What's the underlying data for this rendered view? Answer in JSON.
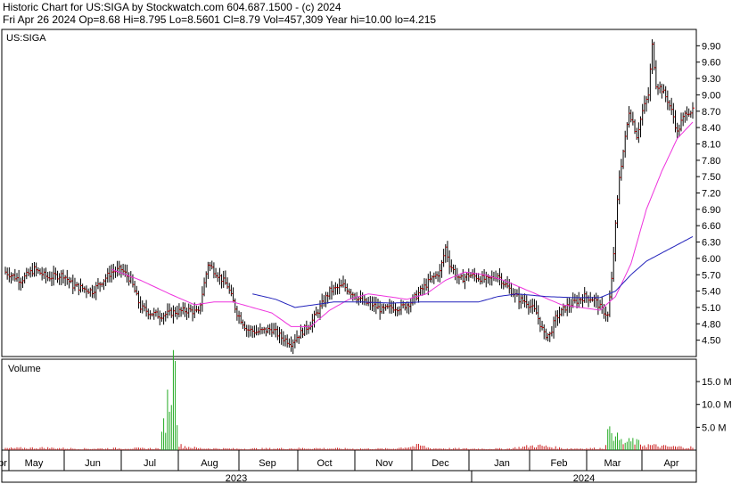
{
  "header": {
    "line1": "Historic Chart for US:SIGA by Stockwatch.com 604.687.1500 - (c) 2024",
    "line2": "Fri Apr 26 2024  Op=8.68  Hi=8.795  Lo=8.5601  Cl=8.79  Vol=457,309  Year hi=10.00  lo=4.215"
  },
  "chart_data": {
    "type": "ohlc",
    "symbol_label": "US:SIGA",
    "volume_label": "Volume",
    "price_ticks": [
      "9.90",
      "9.60",
      "9.30",
      "9.00",
      "8.70",
      "8.40",
      "8.10",
      "7.80",
      "7.50",
      "7.20",
      "6.90",
      "6.60",
      "6.30",
      "6.00",
      "5.70",
      "5.40",
      "5.10",
      "4.80",
      "4.50"
    ],
    "price_tick_values": [
      9.9,
      9.6,
      9.3,
      9.0,
      8.7,
      8.4,
      8.1,
      7.8,
      7.5,
      7.2,
      6.9,
      6.6,
      6.3,
      6.0,
      5.7,
      5.4,
      5.1,
      4.8,
      4.5
    ],
    "ylim": [
      4.2,
      10.2
    ],
    "volume_ticks": [
      "15.0 M",
      "10.0 M",
      "5.0 M"
    ],
    "volume_tick_values": [
      15,
      10,
      5
    ],
    "volume_ylim": [
      0,
      19.5
    ],
    "months": [
      "pr",
      "May",
      "Jun",
      "Jul",
      "Aug",
      "Sep",
      "Oct",
      "Nov",
      "Dec",
      "Jan",
      "Feb",
      "Mar",
      "Apr"
    ],
    "years": [
      "2023",
      "2024"
    ],
    "price_anchors": [
      [
        0,
        5.75
      ],
      [
        8,
        5.6
      ],
      [
        15,
        5.8
      ],
      [
        22,
        5.65
      ],
      [
        30,
        5.7
      ],
      [
        35,
        5.5
      ],
      [
        45,
        5.4
      ],
      [
        55,
        5.75
      ],
      [
        60,
        5.8
      ],
      [
        65,
        5.6
      ],
      [
        70,
        5.1
      ],
      [
        75,
        5.0
      ],
      [
        80,
        4.95
      ],
      [
        88,
        5.02
      ],
      [
        95,
        5.05
      ],
      [
        100,
        5.0
      ],
      [
        105,
        5.9
      ],
      [
        110,
        5.7
      ],
      [
        115,
        5.5
      ],
      [
        120,
        5.0
      ],
      [
        125,
        4.7
      ],
      [
        130,
        4.65
      ],
      [
        138,
        4.7
      ],
      [
        143,
        4.55
      ],
      [
        148,
        4.45
      ],
      [
        152,
        4.6
      ],
      [
        158,
        4.8
      ],
      [
        163,
        5.1
      ],
      [
        168,
        5.4
      ],
      [
        175,
        5.5
      ],
      [
        180,
        5.35
      ],
      [
        185,
        5.2
      ],
      [
        190,
        5.15
      ],
      [
        195,
        5.05
      ],
      [
        200,
        5.1
      ],
      [
        205,
        5.1
      ],
      [
        210,
        5.2
      ],
      [
        215,
        5.4
      ],
      [
        220,
        5.6
      ],
      [
        225,
        5.75
      ],
      [
        228,
        6.2
      ],
      [
        230,
        5.9
      ],
      [
        235,
        5.6
      ],
      [
        240,
        5.7
      ],
      [
        245,
        5.65
      ],
      [
        250,
        5.6
      ],
      [
        255,
        5.7
      ],
      [
        258,
        5.55
      ],
      [
        262,
        5.4
      ],
      [
        266,
        5.25
      ],
      [
        270,
        5.2
      ],
      [
        275,
        5.0
      ],
      [
        279,
        4.6
      ],
      [
        282,
        4.6
      ],
      [
        285,
        4.9
      ],
      [
        290,
        5.1
      ],
      [
        295,
        5.2
      ],
      [
        300,
        5.3
      ],
      [
        305,
        5.25
      ],
      [
        308,
        5.1
      ],
      [
        312,
        4.95
      ],
      [
        314,
        5.6
      ],
      [
        316,
        6.6
      ],
      [
        318,
        7.5
      ],
      [
        321,
        8.2
      ],
      [
        323,
        8.7
      ],
      [
        325,
        8.5
      ],
      [
        327,
        8.25
      ],
      [
        330,
        8.7
      ],
      [
        333,
        9.0
      ],
      [
        335,
        9.9
      ],
      [
        337,
        9.2
      ],
      [
        340,
        9.1
      ],
      [
        343,
        8.9
      ],
      [
        346,
        8.6
      ],
      [
        348,
        8.3
      ],
      [
        350,
        8.5
      ],
      [
        353,
        8.7
      ]
    ],
    "ma_short_anchors": [
      [
        55,
        5.8
      ],
      [
        70,
        5.6
      ],
      [
        85,
        5.35
      ],
      [
        98,
        5.15
      ],
      [
        108,
        5.2
      ],
      [
        118,
        5.2
      ],
      [
        128,
        5.1
      ],
      [
        138,
        5.0
      ],
      [
        148,
        4.75
      ],
      [
        158,
        4.75
      ],
      [
        168,
        5.05
      ],
      [
        178,
        5.25
      ],
      [
        188,
        5.35
      ],
      [
        198,
        5.3
      ],
      [
        208,
        5.25
      ],
      [
        218,
        5.35
      ],
      [
        228,
        5.6
      ],
      [
        238,
        5.75
      ],
      [
        248,
        5.7
      ],
      [
        258,
        5.6
      ],
      [
        268,
        5.45
      ],
      [
        278,
        5.3
      ],
      [
        288,
        5.15
      ],
      [
        298,
        5.1
      ],
      [
        308,
        5.05
      ],
      [
        316,
        5.3
      ],
      [
        324,
        5.9
      ],
      [
        332,
        6.9
      ],
      [
        340,
        7.6
      ],
      [
        348,
        8.2
      ],
      [
        356,
        8.5
      ]
    ],
    "ma_long_anchors": [
      [
        128,
        5.35
      ],
      [
        140,
        5.25
      ],
      [
        150,
        5.1
      ],
      [
        160,
        5.15
      ],
      [
        170,
        5.2
      ],
      [
        185,
        5.2
      ],
      [
        200,
        5.18
      ],
      [
        215,
        5.2
      ],
      [
        230,
        5.2
      ],
      [
        245,
        5.2
      ],
      [
        255,
        5.3
      ],
      [
        265,
        5.35
      ],
      [
        280,
        5.3
      ],
      [
        295,
        5.28
      ],
      [
        308,
        5.28
      ],
      [
        316,
        5.4
      ],
      [
        324,
        5.7
      ],
      [
        332,
        5.95
      ],
      [
        340,
        6.1
      ],
      [
        348,
        6.25
      ],
      [
        356,
        6.4
      ]
    ],
    "volume_anchors": [
      [
        0,
        0.4
      ],
      [
        20,
        0.5
      ],
      [
        40,
        0.3
      ],
      [
        60,
        0.4
      ],
      [
        80,
        0.35
      ],
      [
        88,
        19.5
      ],
      [
        90,
        1.0
      ],
      [
        100,
        0.4
      ],
      [
        120,
        0.3
      ],
      [
        140,
        0.35
      ],
      [
        160,
        0.4
      ],
      [
        180,
        0.3
      ],
      [
        200,
        0.3
      ],
      [
        215,
        1.0
      ],
      [
        220,
        0.4
      ],
      [
        240,
        0.3
      ],
      [
        260,
        0.3
      ],
      [
        275,
        1.0
      ],
      [
        290,
        0.35
      ],
      [
        310,
        0.4
      ],
      [
        313,
        5.2
      ],
      [
        316,
        3.0
      ],
      [
        320,
        1.5
      ],
      [
        325,
        2.0
      ],
      [
        330,
        1.2
      ],
      [
        340,
        0.8
      ],
      [
        356,
        0.6
      ]
    ],
    "seed": 7
  },
  "colors": {
    "bar": "#000000",
    "close_tick": "#dd0000",
    "ma_short": "#ee33dd",
    "ma_long": "#2222bb",
    "vol_bar": "#cc2222",
    "vol_spike": "#22aa22",
    "grid_border": "#000000"
  }
}
